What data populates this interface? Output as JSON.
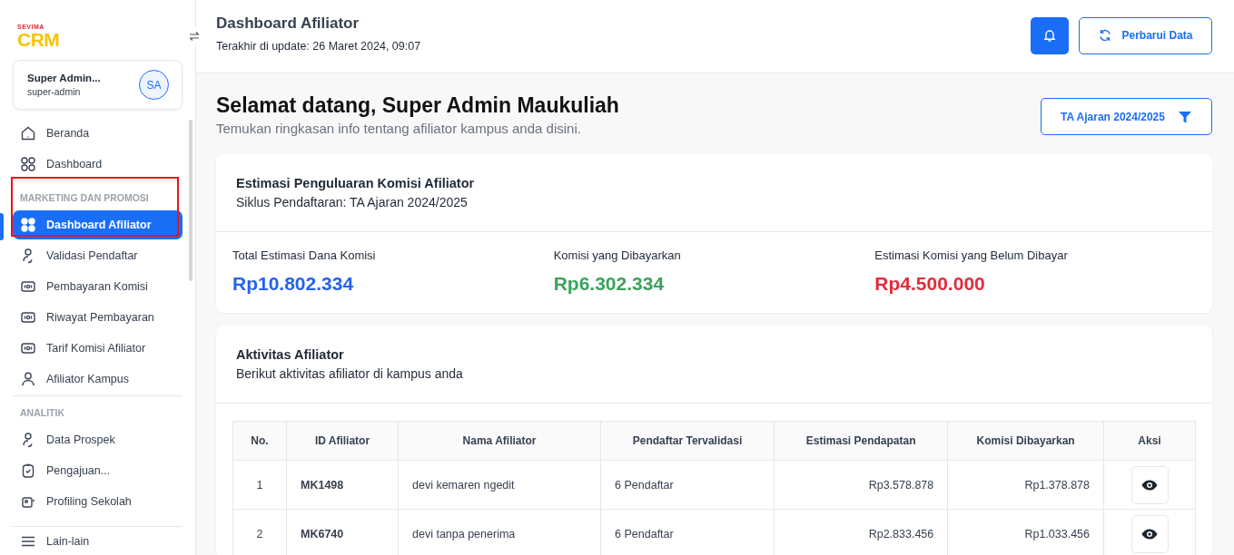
{
  "logo": {
    "brand": "SEVIMA",
    "product": "CRM"
  },
  "user": {
    "name": "Super Admin...",
    "role": "super-admin",
    "initials": "SA"
  },
  "sidebar": {
    "sections": [
      {
        "items": [
          {
            "label": "Beranda",
            "selected": false
          },
          {
            "label": "Dashboard",
            "selected": false
          }
        ]
      },
      {
        "heading": "MARKETING DAN PROMOSI",
        "items": [
          {
            "label": "Dashboard Afiliator",
            "selected": true
          },
          {
            "label": "Validasi Pendaftar",
            "selected": false
          },
          {
            "label": "Pembayaran Komisi",
            "selected": false
          },
          {
            "label": "Riwayat Pembayaran",
            "selected": false
          },
          {
            "label": "Tarif Komisi Afiliator",
            "selected": false
          },
          {
            "label": "Afiliator Kampus",
            "selected": false
          }
        ]
      },
      {
        "heading": "ANALITIK",
        "items": [
          {
            "label": "Data Prospek",
            "selected": false
          },
          {
            "label": "Pengajuan...",
            "selected": false
          },
          {
            "label": "Profiling Sekolah",
            "selected": false
          }
        ]
      }
    ],
    "footer": "Lain-lain"
  },
  "header": {
    "title": "Dashboard Afiliator",
    "updated": "Terakhir di update: 26 Maret 2024, 09:07",
    "refresh_button": "Perbarui Data"
  },
  "welcome": {
    "title": "Selamat datang, Super Admin Maukuliah",
    "subtitle": "Temukan ringkasan info tentang afiliator kampus anda disini.",
    "filter": "TA Ajaran 2024/2025"
  },
  "summary": {
    "title": "Estimasi Penguluaran Komisi Afiliator",
    "subtitle": "Siklus Pendaftaran: TA Ajaran 2024/2025",
    "stats": [
      {
        "label": "Total Estimasi Dana Komisi",
        "value": "Rp10.802.334",
        "color": "#2563eb"
      },
      {
        "label": "Komisi yang Dibayarkan",
        "value": "Rp6.302.334",
        "color": "#3aa35c"
      },
      {
        "label": "Estimasi Komisi yang Belum Dibayar",
        "value": "Rp4.500.000",
        "color": "#e02d3c"
      }
    ]
  },
  "activity": {
    "title": "Aktivitas Afiliator",
    "subtitle": "Berikut aktivitas afiliator di kampus anda",
    "columns": [
      "No.",
      "ID Afiliator",
      "Nama Afiliator",
      "Pendaftar Tervalidasi",
      "Estimasi Pendapatan",
      "Komisi Dibayarkan",
      "Aksi"
    ],
    "rows": [
      {
        "no": "1",
        "id": "MK1498",
        "name": "devi kemaren ngedit",
        "registrants": "6 Pendaftar",
        "estimate": "Rp3.578.878",
        "paid": "Rp1.378.878"
      },
      {
        "no": "2",
        "id": "MK6740",
        "name": "devi tanpa penerima",
        "registrants": "6 Pendaftar",
        "estimate": "Rp2.833.456",
        "paid": "Rp1.033.456"
      }
    ]
  }
}
